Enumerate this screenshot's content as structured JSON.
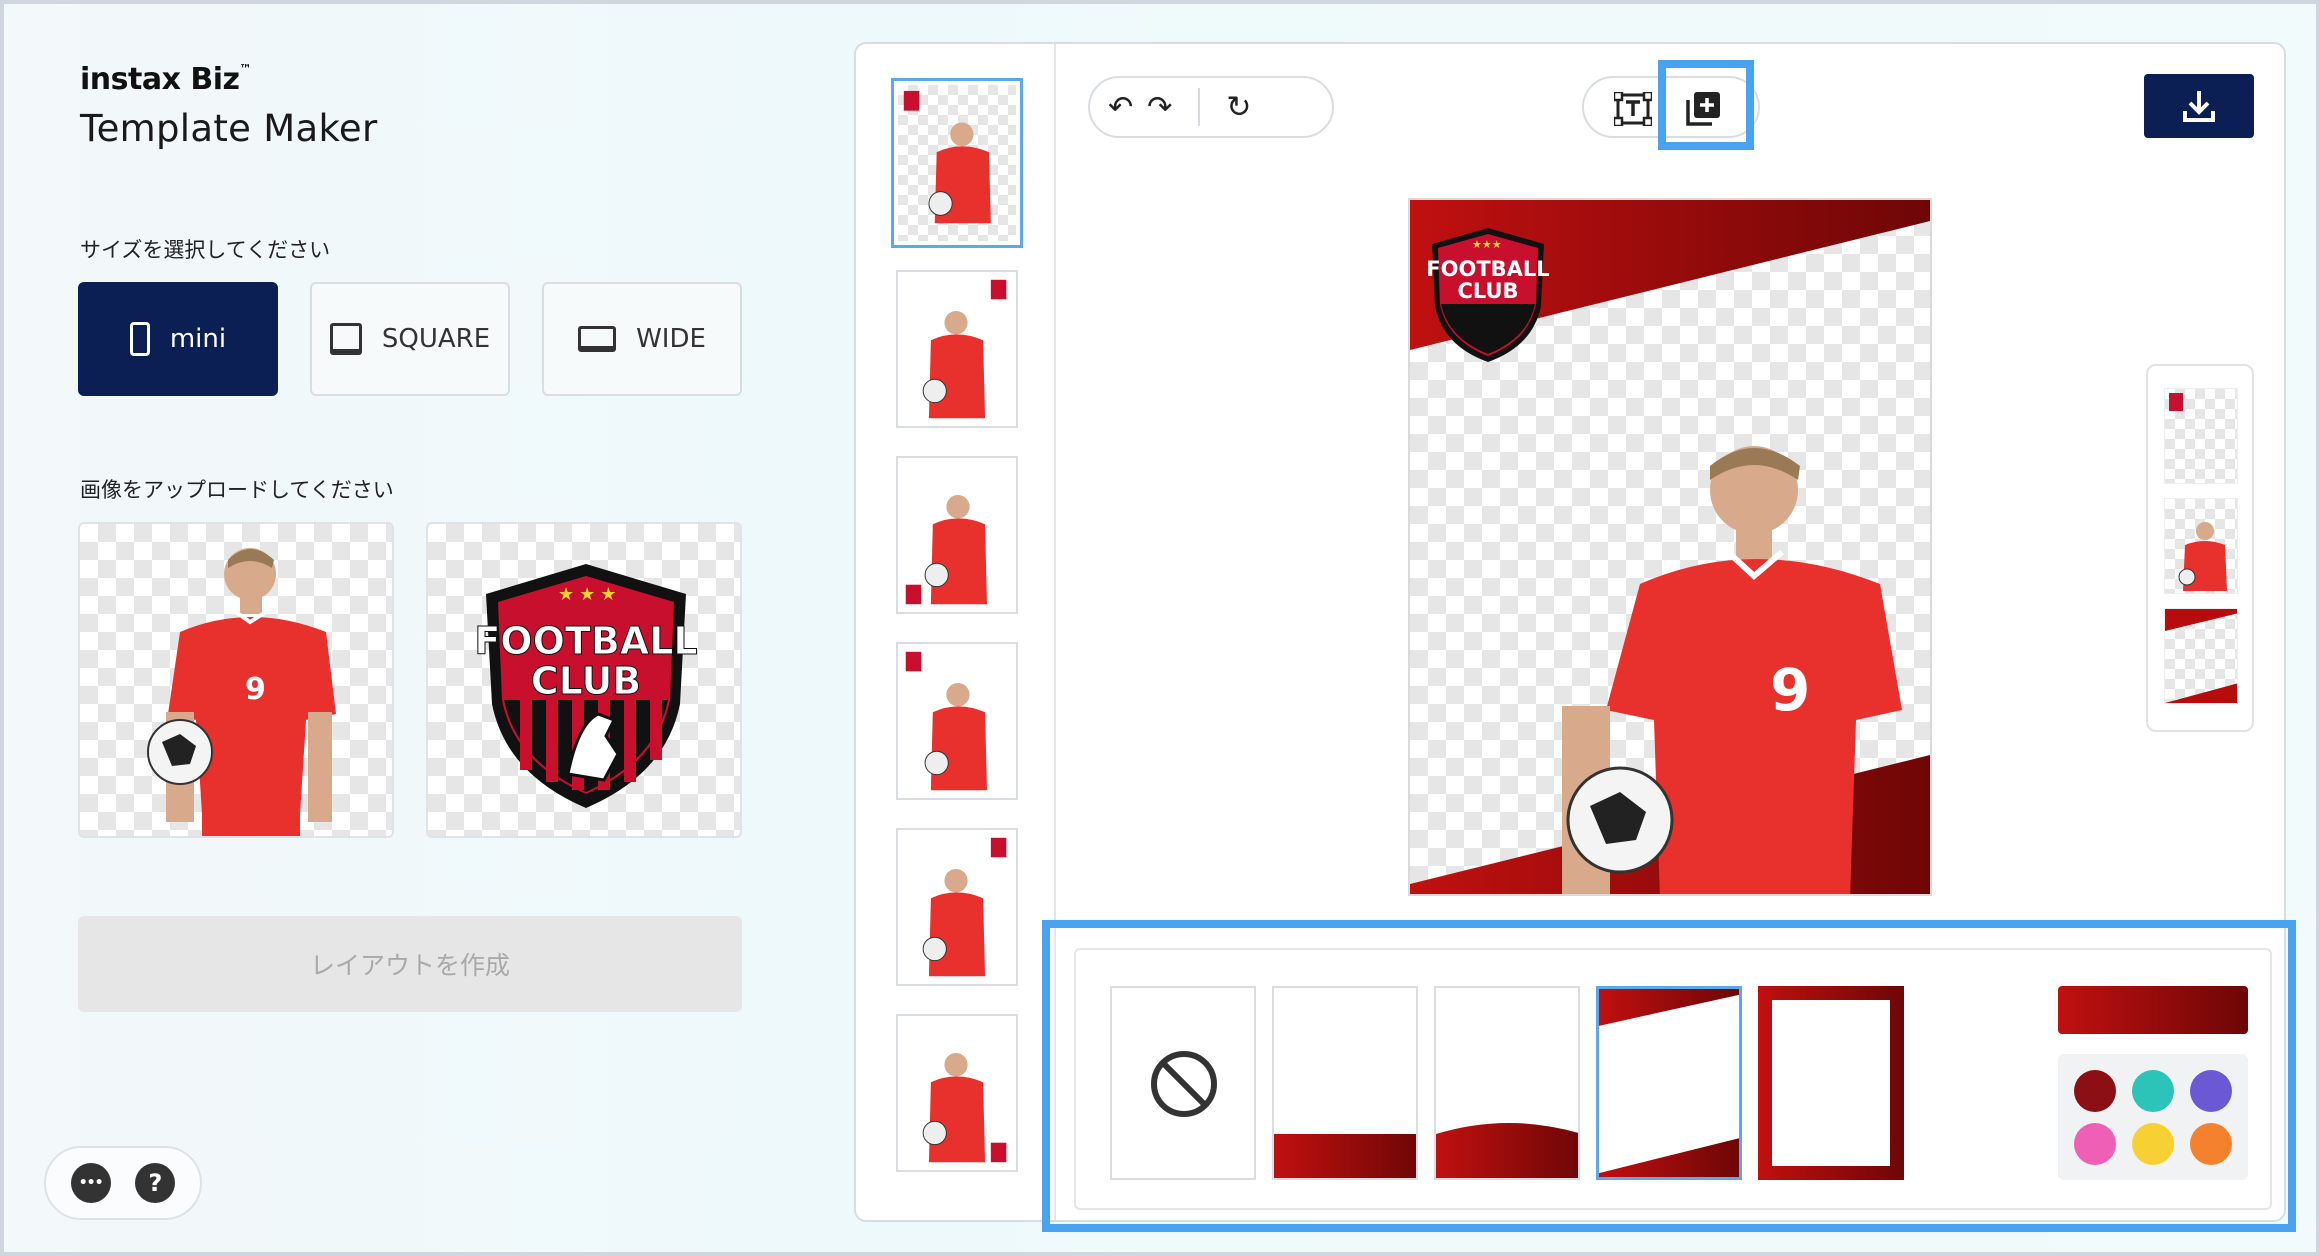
{
  "brand": {
    "logo": "instax Biz",
    "tm": "™",
    "title": "Template Maker"
  },
  "size_section": {
    "label": "サイズを選択してください",
    "options": [
      {
        "label": "mini",
        "icon": "phone-portrait-icon",
        "selected": true
      },
      {
        "label": "SQUARE",
        "icon": "square-frame-icon",
        "selected": false
      },
      {
        "label": "WIDE",
        "icon": "wide-frame-icon",
        "selected": false
      }
    ]
  },
  "upload_section": {
    "label": "画像をアップロードしてください",
    "badge": {
      "line1": "FOOTBALL",
      "line2": "CLUB"
    },
    "player_number": "9"
  },
  "create_button": {
    "label": "レイアウトを作成",
    "enabled": false
  },
  "help": {
    "more": "•••",
    "question": "?"
  },
  "toolbar": {
    "undo": "↶",
    "redo": "↷",
    "reset": "↻"
  },
  "frames": {
    "selected_index": 3,
    "options": [
      "none",
      "bottom-band",
      "bottom-wave",
      "diagonal",
      "border"
    ],
    "none_symbol": "⊘"
  },
  "colors": {
    "accent": "#c01010",
    "gradient": [
      "#c01010",
      "#6e0606"
    ],
    "swatches": [
      "#8b0f14",
      "#2cc3b8",
      "#6b59d3",
      "#ef5fb6",
      "#f7d134",
      "#f4812d"
    ],
    "brand_navy": "#0b1f55",
    "highlight": "#4aa3f0"
  }
}
